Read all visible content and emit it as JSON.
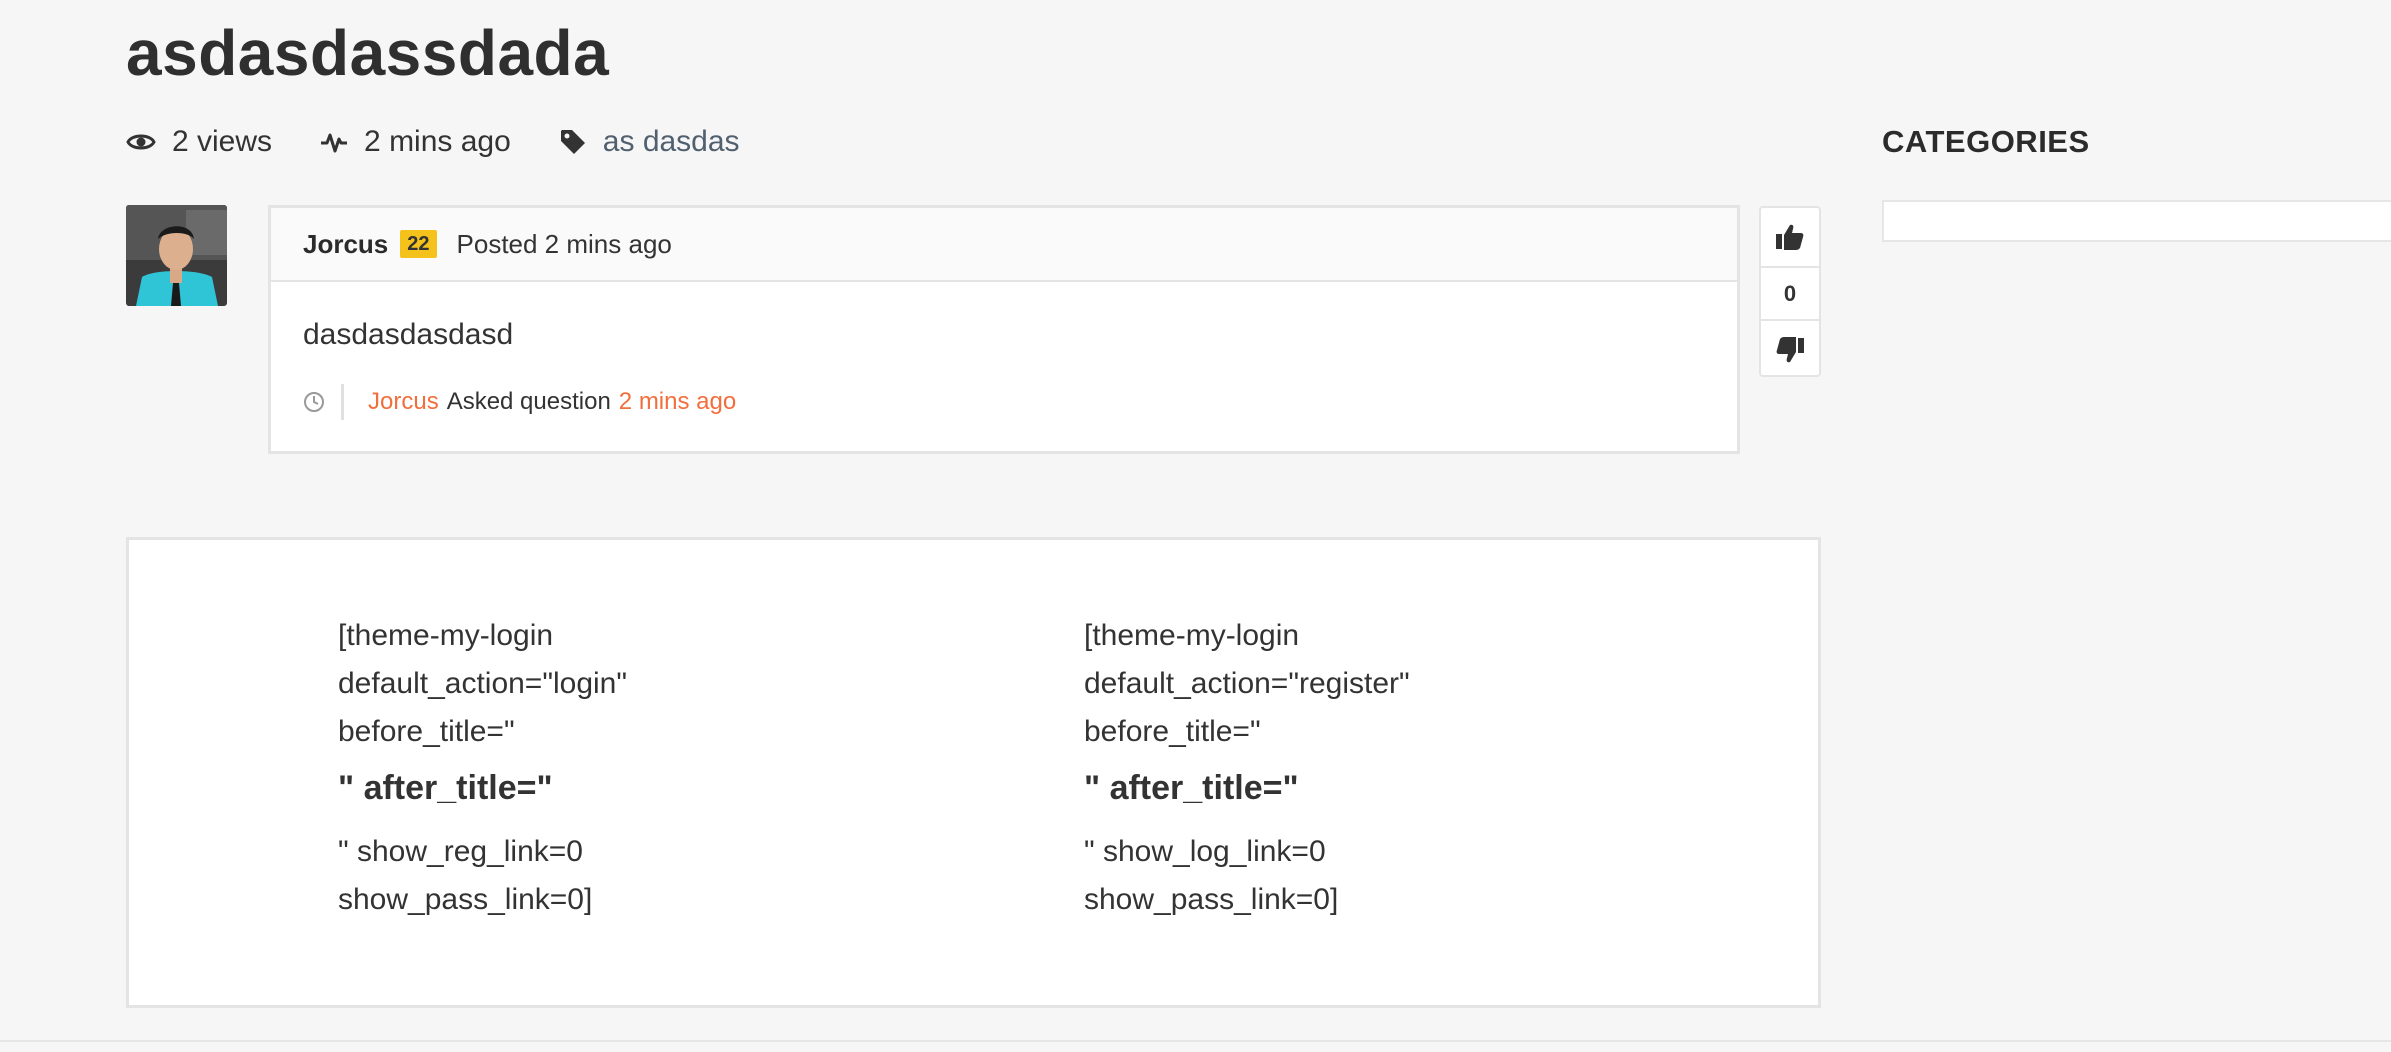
{
  "question": {
    "title": "asdasdassdada",
    "views": "2 views",
    "activity": "2 mins ago",
    "tag": "as dasdas"
  },
  "sidebar": {
    "categories_title": "CATEGORIES"
  },
  "post": {
    "author": "Jorcus",
    "reputation": "22",
    "posted": "Posted 2 mins ago",
    "body": "dasdasdasdasd",
    "activity_author": "Jorcus",
    "activity_action": "Asked question",
    "activity_time": "2 mins ago"
  },
  "vote": {
    "count": "0"
  },
  "shortcodes": {
    "left": {
      "line1": "[theme-my-login",
      "line2": "default_action=\"login\"",
      "line3": "before_title=\"",
      "heading": "\" after_title=\"",
      "line4": "\" show_reg_link=0",
      "line5": "show_pass_link=0]"
    },
    "right": {
      "line1": "[theme-my-login",
      "line2": "default_action=\"register\"",
      "line3": "before_title=\"",
      "heading": "\" after_title=\"",
      "line4": "\" show_log_link=0",
      "line5": "show_pass_link=0]"
    }
  },
  "icons": {
    "views": "eye-icon",
    "activity": "pulse-icon",
    "tag": "tag-icon",
    "clock": "clock-icon",
    "upvote": "thumbs-up-icon",
    "downvote": "thumbs-down-icon"
  },
  "colors": {
    "background": "#f6f6f6",
    "accent": "#f26f3d",
    "reputation_badge": "#f5c21b",
    "tag_link": "#51606f"
  }
}
